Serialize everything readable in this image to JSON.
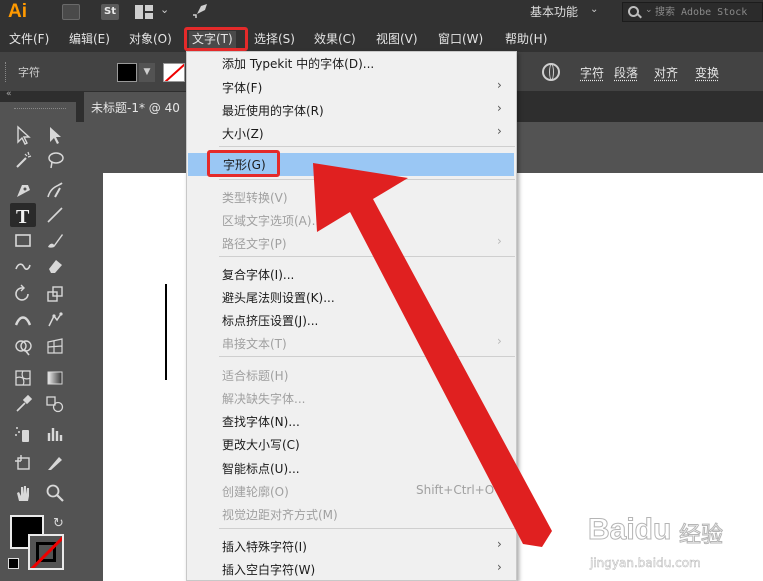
{
  "app": {
    "logo": "Ai",
    "bridge_label": "Br",
    "stock_label": "St",
    "workspace": "基本功能",
    "search_placeholder": "搜索 Adobe Stock"
  },
  "menubar": {
    "items": [
      {
        "label": "文件(F)"
      },
      {
        "label": "编辑(E)"
      },
      {
        "label": "对象(O)"
      },
      {
        "label": "文字(T)"
      },
      {
        "label": "选择(S)"
      },
      {
        "label": "效果(C)"
      },
      {
        "label": "视图(V)"
      },
      {
        "label": "窗口(W)"
      },
      {
        "label": "帮助(H)"
      }
    ],
    "active_index": 3
  },
  "control_bar": {
    "label": "字符",
    "links": [
      "字符",
      "段落",
      "对齐",
      "变换"
    ]
  },
  "document": {
    "tab_title": "未标题-1* @ 40"
  },
  "dropdown": {
    "items": [
      {
        "label": "添加 Typekit 中的字体(D)...",
        "disabled": false,
        "submenu": false
      },
      {
        "label": "字体(F)",
        "disabled": false,
        "submenu": true
      },
      {
        "label": "最近使用的字体(R)",
        "disabled": false,
        "submenu": true
      },
      {
        "label": "大小(Z)",
        "disabled": false,
        "submenu": true
      },
      {
        "label": "字形(G)",
        "disabled": false,
        "submenu": false,
        "highlighted": true
      },
      {
        "label": "类型转换(V)",
        "disabled": true,
        "submenu": false
      },
      {
        "label": "区域文字选项(A)...",
        "disabled": true,
        "submenu": false
      },
      {
        "label": "路径文字(P)",
        "disabled": true,
        "submenu": true
      },
      {
        "label": "复合字体(I)...",
        "disabled": false,
        "submenu": false
      },
      {
        "label": "避头尾法则设置(K)...",
        "disabled": false,
        "submenu": false
      },
      {
        "label": "标点挤压设置(J)...",
        "disabled": false,
        "submenu": false
      },
      {
        "label": "串接文本(T)",
        "disabled": true,
        "submenu": true
      },
      {
        "label": "适合标题(H)",
        "disabled": true,
        "submenu": false
      },
      {
        "label": "解决缺失字体...",
        "disabled": true,
        "submenu": false
      },
      {
        "label": "查找字体(N)...",
        "disabled": false,
        "submenu": false
      },
      {
        "label": "更改大小写(C)",
        "disabled": false,
        "submenu": true
      },
      {
        "label": "智能标点(U)...",
        "disabled": false,
        "submenu": false
      },
      {
        "label": "创建轮廓(O)",
        "disabled": true,
        "submenu": false,
        "shortcut": "Shift+Ctrl+O"
      },
      {
        "label": "视觉边距对齐方式(M)",
        "disabled": true,
        "submenu": false
      },
      {
        "label": "插入特殊字符(I)",
        "disabled": false,
        "submenu": true
      },
      {
        "label": "插入空白字符(W)",
        "disabled": false,
        "submenu": true
      }
    ]
  },
  "toolbar": {
    "tools": [
      {
        "icon": "selection-tool-icon"
      },
      {
        "icon": "direct-selection-tool-icon"
      },
      {
        "icon": "magic-wand-tool-icon"
      },
      {
        "icon": "lasso-tool-icon"
      },
      {
        "icon": "pen-tool-icon"
      },
      {
        "icon": "curvature-tool-icon"
      },
      {
        "icon": "type-tool-icon",
        "selected": true
      },
      {
        "icon": "line-segment-tool-icon"
      },
      {
        "icon": "rectangle-tool-icon"
      },
      {
        "icon": "paintbrush-tool-icon"
      },
      {
        "icon": "shaper-tool-icon"
      },
      {
        "icon": "eraser-tool-icon"
      },
      {
        "icon": "rotate-tool-icon"
      },
      {
        "icon": "scale-tool-icon"
      },
      {
        "icon": "width-tool-icon"
      },
      {
        "icon": "puppet-warp-tool-icon"
      },
      {
        "icon": "shape-builder-tool-icon"
      },
      {
        "icon": "perspective-grid-tool-icon"
      },
      {
        "icon": "mesh-tool-icon"
      },
      {
        "icon": "gradient-tool-icon"
      },
      {
        "icon": "eyedropper-tool-icon"
      },
      {
        "icon": "blend-tool-icon"
      },
      {
        "icon": "symbol-sprayer-tool-icon"
      },
      {
        "icon": "column-graph-tool-icon"
      },
      {
        "icon": "artboard-tool-icon"
      },
      {
        "icon": "slice-tool-icon"
      },
      {
        "icon": "hand-tool-icon"
      },
      {
        "icon": "zoom-tool-icon"
      }
    ]
  },
  "watermark": {
    "brand": "Baidu",
    "product": "经验",
    "url": "jingyan.baidu.com"
  },
  "colors": {
    "highlight": "#9ac7f4",
    "annotation_red": "#e42a2a",
    "ai_orange": "#ff9a00"
  }
}
